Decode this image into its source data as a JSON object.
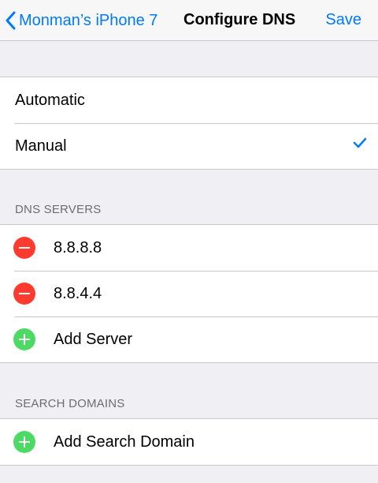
{
  "navbar": {
    "back_label": "Monman’s iPhone 7",
    "title": "Configure DNS",
    "save_label": "Save"
  },
  "mode": {
    "options": [
      {
        "label": "Automatic",
        "selected": false
      },
      {
        "label": "Manual",
        "selected": true
      }
    ]
  },
  "dns_servers": {
    "header": "DNS SERVERS",
    "servers": [
      "8.8.8.8",
      "8.8.4.4"
    ],
    "add_label": "Add Server"
  },
  "search_domains": {
    "header": "SEARCH DOMAINS",
    "add_label": "Add Search Domain"
  },
  "colors": {
    "accent": "#007aff",
    "delete": "#ff3b30",
    "add": "#4cd964",
    "background": "#efeff4"
  }
}
